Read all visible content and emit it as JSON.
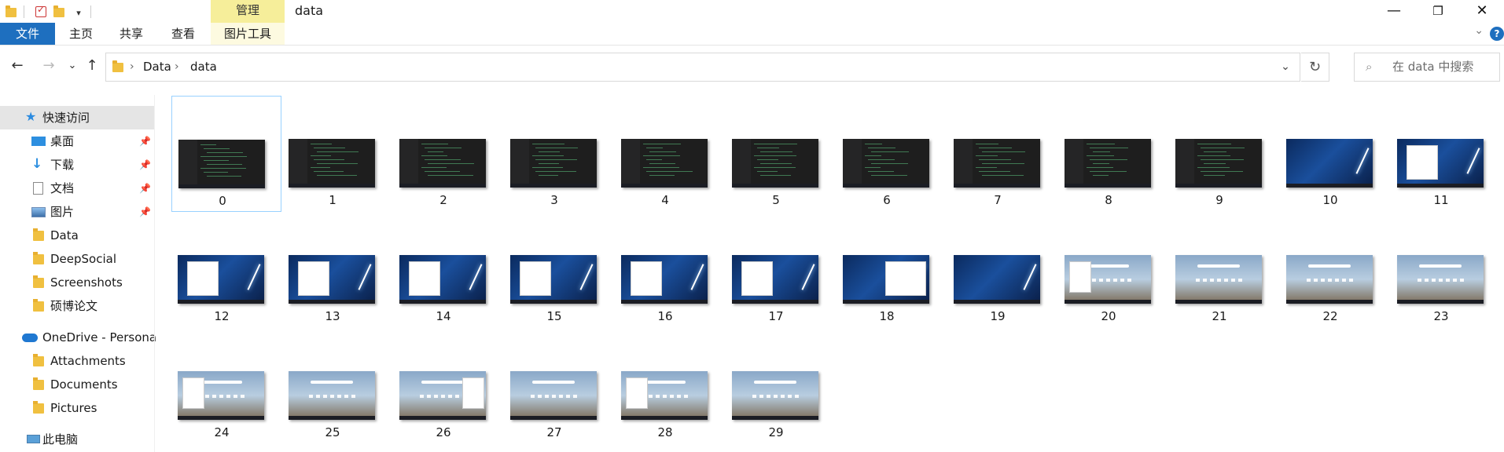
{
  "window": {
    "title": "data",
    "manage_tab": "管理",
    "controls": {
      "minimize": "—",
      "maximize": "❐",
      "close": "✕"
    }
  },
  "ribbon": {
    "tabs": [
      {
        "label": "文件"
      },
      {
        "label": "主页"
      },
      {
        "label": "共享"
      },
      {
        "label": "查看"
      },
      {
        "label": "图片工具"
      }
    ],
    "file_tab_color": "#1e6fbf",
    "manage_color": "#f6ee9a"
  },
  "address": {
    "crumbs": [
      "Data",
      "data"
    ]
  },
  "search": {
    "placeholder": "在 data 中搜索"
  },
  "sidebar": {
    "quick_access": "快速访问",
    "items": [
      {
        "label": "桌面",
        "icon": "desktop-icon",
        "pinned": true
      },
      {
        "label": "下载",
        "icon": "download-icon",
        "pinned": true
      },
      {
        "label": "文档",
        "icon": "document-icon",
        "pinned": true
      },
      {
        "label": "图片",
        "icon": "picture-icon",
        "pinned": true
      },
      {
        "label": "Data",
        "icon": "folder-icon",
        "pinned": false
      },
      {
        "label": "DeepSocial",
        "icon": "folder-icon",
        "pinned": false
      },
      {
        "label": "Screenshots",
        "icon": "folder-icon",
        "pinned": false
      },
      {
        "label": "硕博论文",
        "icon": "folder-icon",
        "pinned": false
      }
    ],
    "onedrive": "OneDrive - Persona",
    "onedrive_items": [
      "Attachments",
      "Documents",
      "Pictures"
    ],
    "this_pc": "此电脑"
  },
  "files": [
    {
      "name": "0",
      "kind": "code"
    },
    {
      "name": "1",
      "kind": "code"
    },
    {
      "name": "2",
      "kind": "code"
    },
    {
      "name": "3",
      "kind": "code"
    },
    {
      "name": "4",
      "kind": "code"
    },
    {
      "name": "5",
      "kind": "code"
    },
    {
      "name": "6",
      "kind": "code"
    },
    {
      "name": "7",
      "kind": "code"
    },
    {
      "name": "8",
      "kind": "code"
    },
    {
      "name": "9",
      "kind": "code"
    },
    {
      "name": "10",
      "kind": "desk"
    },
    {
      "name": "11",
      "kind": "desk"
    },
    {
      "name": "12",
      "kind": "desk"
    },
    {
      "name": "13",
      "kind": "desk"
    },
    {
      "name": "14",
      "kind": "desk"
    },
    {
      "name": "15",
      "kind": "desk"
    },
    {
      "name": "16",
      "kind": "desk"
    },
    {
      "name": "17",
      "kind": "desk"
    },
    {
      "name": "18",
      "kind": "desk"
    },
    {
      "name": "19",
      "kind": "desk"
    },
    {
      "name": "20",
      "kind": "sky"
    },
    {
      "name": "21",
      "kind": "sky"
    },
    {
      "name": "22",
      "kind": "sky"
    },
    {
      "name": "23",
      "kind": "sky"
    },
    {
      "name": "24",
      "kind": "sky"
    },
    {
      "name": "25",
      "kind": "sky"
    },
    {
      "name": "26",
      "kind": "sky"
    },
    {
      "name": "27",
      "kind": "sky"
    },
    {
      "name": "28",
      "kind": "sky"
    },
    {
      "name": "29",
      "kind": "sky"
    }
  ],
  "selected_file": "0"
}
